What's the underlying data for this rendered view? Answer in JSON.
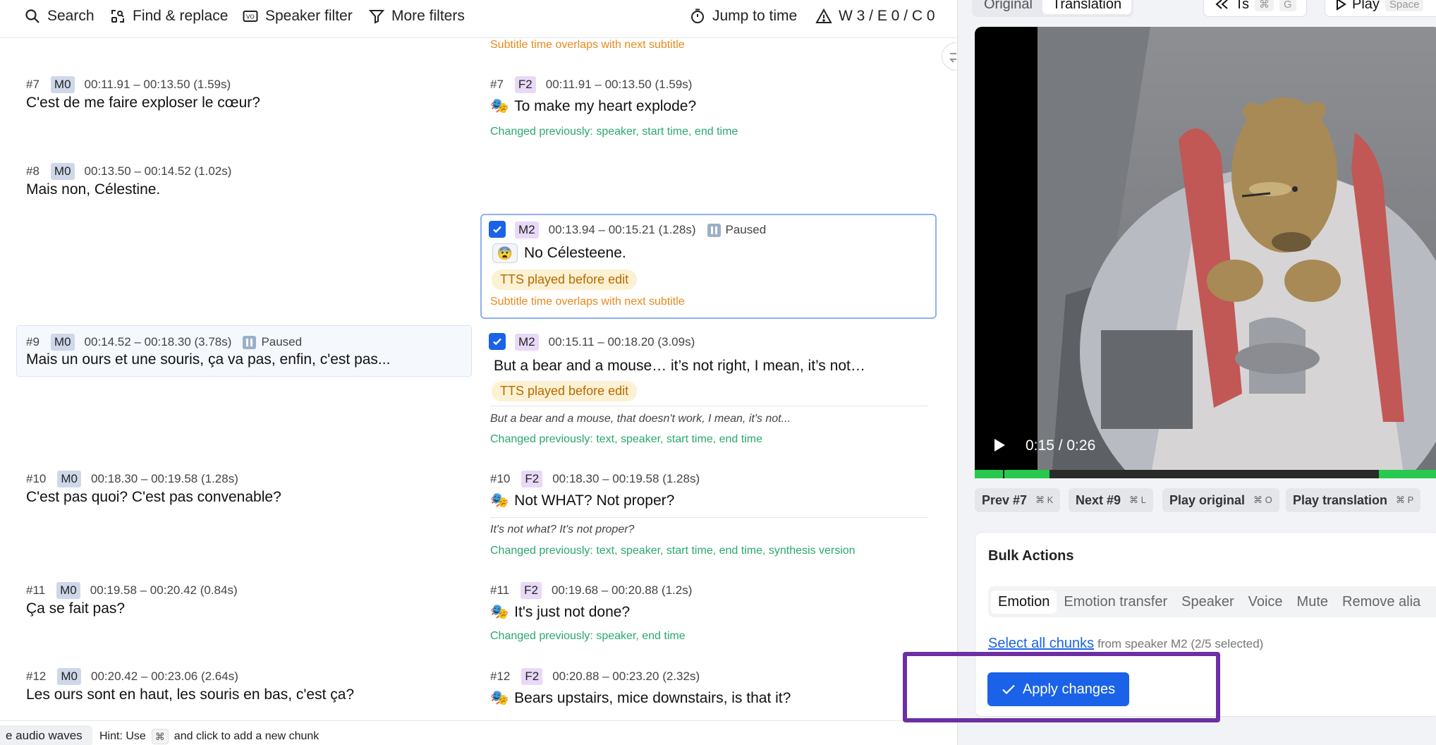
{
  "toolbar": {
    "search": "Search",
    "find_replace": "Find & replace",
    "speaker_filter": "Speaker filter",
    "more_filters": "More filters",
    "jump_to_time": "Jump to time",
    "counts": "W 3 / E 0 / C 0"
  },
  "rows": {
    "top_overlap_warning": "Subtitle time overlaps with next subtitle",
    "r7": {
      "left": {
        "num": "#7",
        "speaker": "M0",
        "time": "00:11.91 – 00:13.50 (1.59s)",
        "text": "C'est de me faire exploser le cœur?"
      },
      "right": {
        "num": "#7",
        "speaker": "F2",
        "time": "00:11.91 – 00:13.50 (1.59s)",
        "emoji": "🎭",
        "text": "To make my heart explode?",
        "changed": "Changed previously: speaker, start time, end time"
      }
    },
    "r8": {
      "left": {
        "num": "#8",
        "speaker": "M0",
        "time": "00:13.50 – 00:14.52 (1.02s)",
        "text": "Mais non, Célestine."
      },
      "right": {
        "speaker": "M2",
        "time": "00:13.94 – 00:15.21 (1.28s)",
        "paused": "Paused",
        "emoji": "😨",
        "text": "No Célesteene.",
        "tts": "TTS played before edit",
        "warning": "Subtitle time overlaps with next subtitle"
      }
    },
    "r9": {
      "left": {
        "num": "#9",
        "speaker": "M0",
        "time": "00:14.52 – 00:18.30 (3.78s)",
        "paused": "Paused",
        "text": "Mais un ours et une souris, ça va pas, enfin, c'est pas..."
      },
      "right": {
        "speaker": "M2",
        "time": "00:15.11 – 00:18.20 (3.09s)",
        "text": "But a bear and a mouse… it’s not right, I mean, it’s not…",
        "tts": "TTS played before edit",
        "original": "But a bear and a mouse, that doesn't work, I mean, it's not...",
        "changed": "Changed previously: text, speaker, start time, end time"
      }
    },
    "r10": {
      "left": {
        "num": "#10",
        "speaker": "M0",
        "time": "00:18.30 – 00:19.58 (1.28s)",
        "text": "C'est pas quoi? C'est pas convenable?"
      },
      "right": {
        "num": "#10",
        "speaker": "F2",
        "time": "00:18.30 – 00:19.58 (1.28s)",
        "emoji": "🎭",
        "text": "Not WHAT? Not proper?",
        "original": "It's not what? It's not proper?",
        "changed": "Changed previously: text, speaker, start time, end time, synthesis version"
      }
    },
    "r11": {
      "left": {
        "num": "#11",
        "speaker": "M0",
        "time": "00:19.58 – 00:20.42 (0.84s)",
        "text": "Ça se fait pas?"
      },
      "right": {
        "num": "#11",
        "speaker": "F2",
        "time": "00:19.68 – 00:20.88 (1.2s)",
        "emoji": "🎭",
        "text": "It's just not done?",
        "changed": "Changed previously: speaker, end time"
      }
    },
    "r12": {
      "left": {
        "num": "#12",
        "speaker": "M0",
        "time": "00:20.42 – 00:23.06 (2.64s)",
        "text": "Les ours sont en haut, les souris en bas, c'est ça?"
      },
      "right": {
        "num": "#12",
        "speaker": "F2",
        "time": "00:20.88 – 00:23.20 (2.32s)",
        "emoji": "🎭",
        "text": "Bears upstairs, mice downstairs, is that it?"
      }
    }
  },
  "statusbar": {
    "audio_waves": "e audio waves",
    "hint_prefix": "Hint: Use",
    "hint_key": "⌘",
    "hint_suffix": "and click to add a new chunk"
  },
  "right_panel": {
    "tabs": [
      "Original",
      "Translation"
    ],
    "active_tab": "Translation",
    "ts_button": "Ts",
    "ts_key1": "⌘",
    "ts_key2": "G",
    "play_button": "Play",
    "play_key": "Space",
    "video_time": "0:15 / 0:26",
    "nav": {
      "prev": "Prev #7",
      "prev_key": "⌘ K",
      "next": "Next #9",
      "next_key": "⌘ L",
      "play_original": "Play original",
      "play_original_key": "⌘ O",
      "play_translation": "Play translation",
      "play_translation_key": "⌘ P"
    },
    "bulk": {
      "title": "Bulk Actions",
      "tabs": [
        "Emotion",
        "Emotion transfer",
        "Speaker",
        "Voice",
        "Mute",
        "Remove alia"
      ],
      "select_all": "Select all chunks",
      "select_sub": "from speaker M2 (2/5 selected)",
      "apply": "Apply changes"
    }
  },
  "colors": {
    "accent": "#1a63e8",
    "warning": "#e8891c",
    "changed": "#2aa86d",
    "highlight": "#6d2fa3"
  }
}
